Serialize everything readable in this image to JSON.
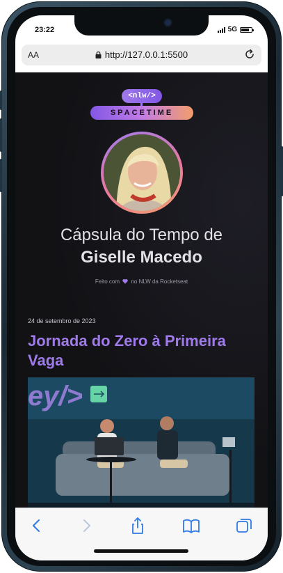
{
  "status": {
    "time": "23:22",
    "network": "5G",
    "battery_level": 0.75
  },
  "browser": {
    "text_size_label": "AA",
    "url": "http://127.0.0.1:5500"
  },
  "page": {
    "logo_top": "<nlw/>",
    "logo_bottom": "SPACETIME",
    "title_line1": "Cápsula do Tempo de",
    "title_line2": "Giselle Macedo",
    "made_with_prefix": "Feito com",
    "made_with_suffix": "no NLW da Rocketseat",
    "memory": {
      "date": "24 de setembro de 2023",
      "title": "Jornada do Zero à Primeira Vaga",
      "image_text": "ey/>"
    }
  },
  "colors": {
    "accent": "#9f7aea",
    "background": "#121215",
    "text": "#e1e1e6"
  }
}
